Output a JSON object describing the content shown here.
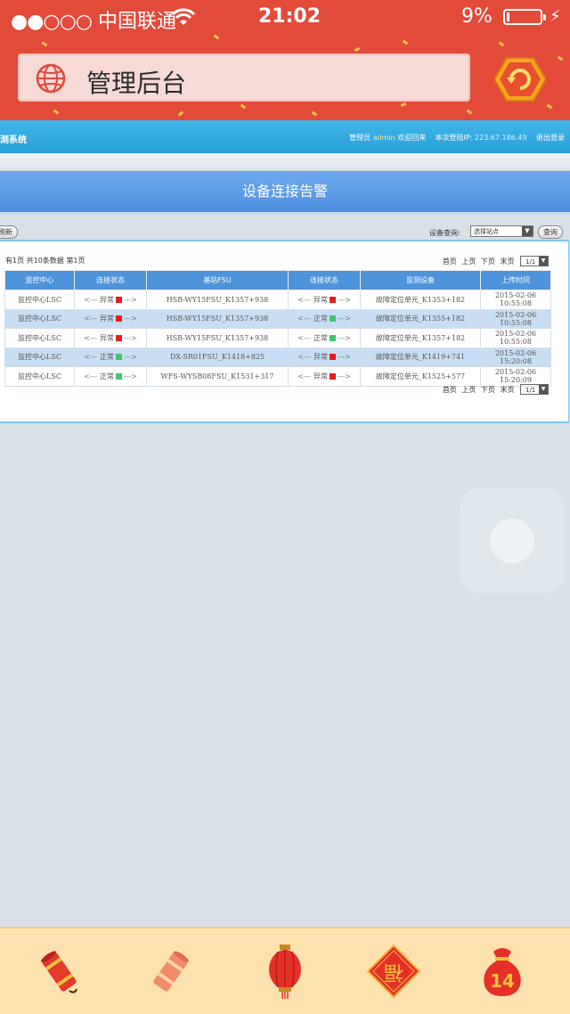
{
  "status_bar": {
    "signal_dots": "●●○○○",
    "carrier": "中国联通",
    "time": "21:02",
    "battery_percent": "9%",
    "battery_level": 0.09
  },
  "browser": {
    "title": "管理后台"
  },
  "app_header": {
    "system_name": "测系统",
    "admin_prefix": "管理员",
    "admin_user": "admin",
    "welcome": "欢迎回来",
    "last_ip_label": "本次登陆IP:",
    "last_ip": "223.67.186.49",
    "logout": "退出登录"
  },
  "page": {
    "title": "设备连接告警",
    "refresh_label": "刷新",
    "device_query_label": "设备查询:",
    "station_select": "选择站点",
    "query_label": "查询",
    "summary": "有1页 共10条数据 第1页",
    "pager": {
      "first": "首页",
      "prev": "上页",
      "next": "下页",
      "last": "末页",
      "page_select": "1/1"
    }
  },
  "table": {
    "columns": [
      "监控中心",
      "连接状态",
      "基站FSU",
      "连接状态",
      "监测设备",
      "上传时间"
    ],
    "arrow_left": "<---",
    "arrow_right": "--->",
    "rows": [
      {
        "center": "监控中心LSC",
        "status1": "异常",
        "status1_color": "red",
        "fsu": "HSB-WY15FSU_K1357+938",
        "status2": "异常",
        "status2_color": "red",
        "device": "故障定位单元_K1353+182",
        "time": "2015-02-06 10:55:08"
      },
      {
        "center": "监控中心LSC",
        "status1": "异常",
        "status1_color": "red",
        "fsu": "HSB-WY15FSU_K1357+938",
        "status2": "正常",
        "status2_color": "green",
        "device": "故障定位单元_K1355+182",
        "time": "2015-02-06 10:55:08"
      },
      {
        "center": "监控中心LSC",
        "status1": "异常",
        "status1_color": "red",
        "fsu": "HSB-WY15FSU_K1357+938",
        "status2": "正常",
        "status2_color": "green",
        "device": "故障定位单元_K1357+182",
        "time": "2015-02-06 10:55:08"
      },
      {
        "center": "监控中心LSC",
        "status1": "正常",
        "status1_color": "green",
        "fsu": "DX-SR01FSU_K1418+825",
        "status2": "异常",
        "status2_color": "red",
        "device": "故障定位单元_K1419+741",
        "time": "2015-02-06 15:20:08"
      },
      {
        "center": "监控中心LSC",
        "status1": "正常",
        "status1_color": "green",
        "fsu": "WFS-WYSB08FSU_K1531+317",
        "status2": "异常",
        "status2_color": "red",
        "device": "故障定位单元_K1525+577",
        "time": "2015-02-06 15:20:09"
      }
    ]
  },
  "bottom_bar": {
    "items": [
      {
        "icon": "firecracker-icon"
      },
      {
        "icon": "firecracker-icon"
      },
      {
        "icon": "lantern-icon"
      },
      {
        "icon": "fu-icon",
        "glyph": "福"
      },
      {
        "icon": "lucky-bag-icon",
        "badge": "14"
      }
    ]
  },
  "colors": {
    "top_red": "#e24a3a",
    "header_blue": "#2a9fd8",
    "banner_blue": "#5b9be6",
    "table_header": "#4f93da",
    "row_alt": "#c7def4",
    "status_red": "#e81c1c",
    "status_green": "#41c470"
  }
}
